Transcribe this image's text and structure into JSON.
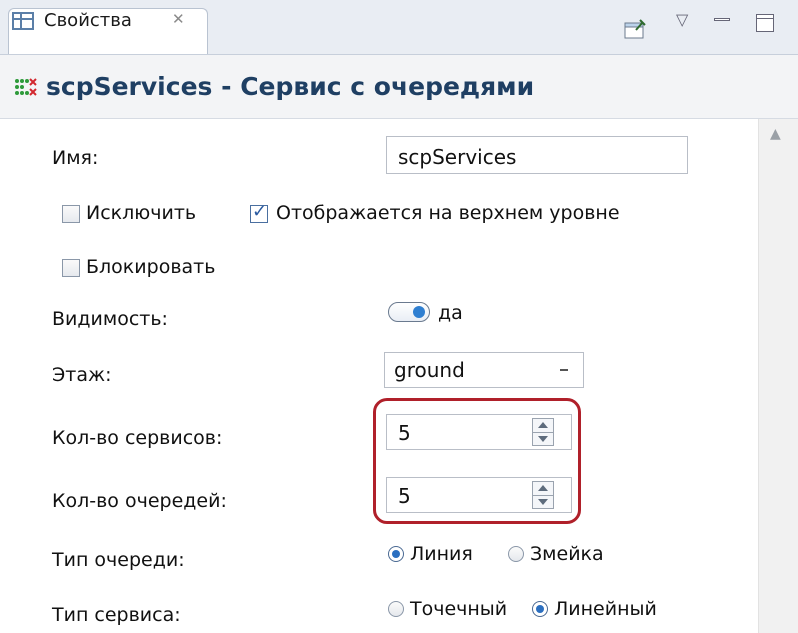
{
  "tab": {
    "label": "Свойства"
  },
  "header": {
    "title": "scpServices - Сервис с очередями"
  },
  "fields": {
    "name": {
      "label": "Имя:",
      "value": "scpServices"
    },
    "exclude": {
      "label": "Исключить",
      "checked": false
    },
    "top_level": {
      "label": "Отображается на верхнем уровне",
      "checked": true
    },
    "lock": {
      "label": "Блокировать",
      "checked": false
    },
    "visibility": {
      "label": "Видимость:",
      "value": "да"
    },
    "floor": {
      "label": "Этаж:",
      "value": "ground"
    },
    "service_count": {
      "label": "Кол-во сервисов:",
      "value": "5"
    },
    "queue_count": {
      "label": "Кол-во очередей:",
      "value": "5"
    },
    "queue_type": {
      "label": "Тип очереди:",
      "options": [
        "Линия",
        "Змейка"
      ],
      "selected": "Линия"
    },
    "service_type": {
      "label": "Тип сервиса:",
      "options": [
        "Точечный",
        "Линейный"
      ],
      "selected": "Линейный"
    }
  },
  "colors": {
    "header_title": "#1f3f63",
    "highlight": "#b0202a",
    "radio_selected": "#2b6fc0"
  }
}
